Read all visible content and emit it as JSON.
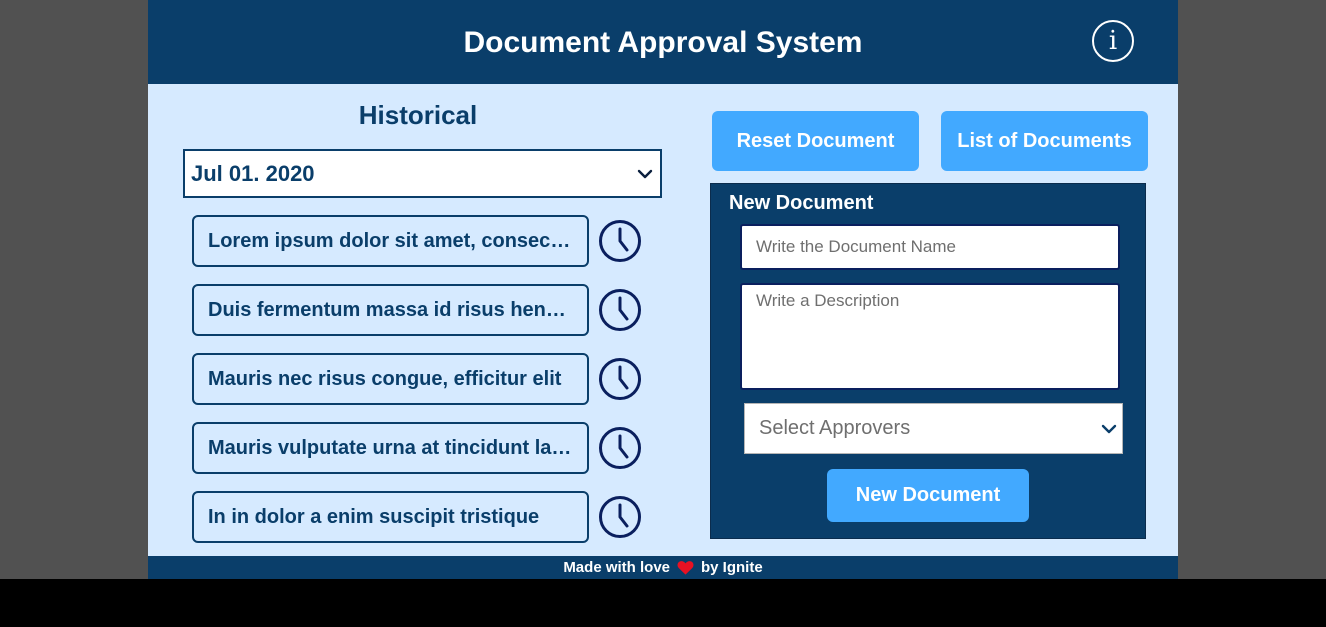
{
  "header": {
    "title": "Document Approval System",
    "info_icon": "info-icon",
    "info_glyph": "i"
  },
  "historical": {
    "title": "Historical",
    "date_select": {
      "selected": "Jul 01. 2020",
      "icon": "chevron-down-icon"
    },
    "items": [
      {
        "label": "Lorem ipsum dolor sit amet, consectetur adipiscing elit",
        "icon": "clock-icon"
      },
      {
        "label": "Duis fermentum massa id risus hendrerit",
        "icon": "clock-icon"
      },
      {
        "label": "Mauris nec risus congue, efficitur elit",
        "icon": "clock-icon"
      },
      {
        "label": "Mauris vulputate urna at tincidunt lacinia",
        "icon": "clock-icon"
      },
      {
        "label": "In in dolor a enim suscipit tristique",
        "icon": "clock-icon"
      }
    ]
  },
  "actions": {
    "reset_label": "Reset Document",
    "list_label": "List of Documents"
  },
  "new_document": {
    "title": "New Document",
    "name_placeholder": "Write the Document Name",
    "name_value": "",
    "description_placeholder": "Write a Description",
    "description_value": "",
    "approvers_placeholder": "Select Approvers",
    "approvers_icon": "chevron-down-icon",
    "submit_label": "New Document"
  },
  "footer": {
    "text_before": "Made with love",
    "heart_icon": "heart-icon",
    "text_after": "by Ignite"
  },
  "colors": {
    "primary_dark": "#0a3e6a",
    "accent_blue": "#42a9ff",
    "panel_background": "#d6eaff",
    "heart_red": "#e81123"
  }
}
